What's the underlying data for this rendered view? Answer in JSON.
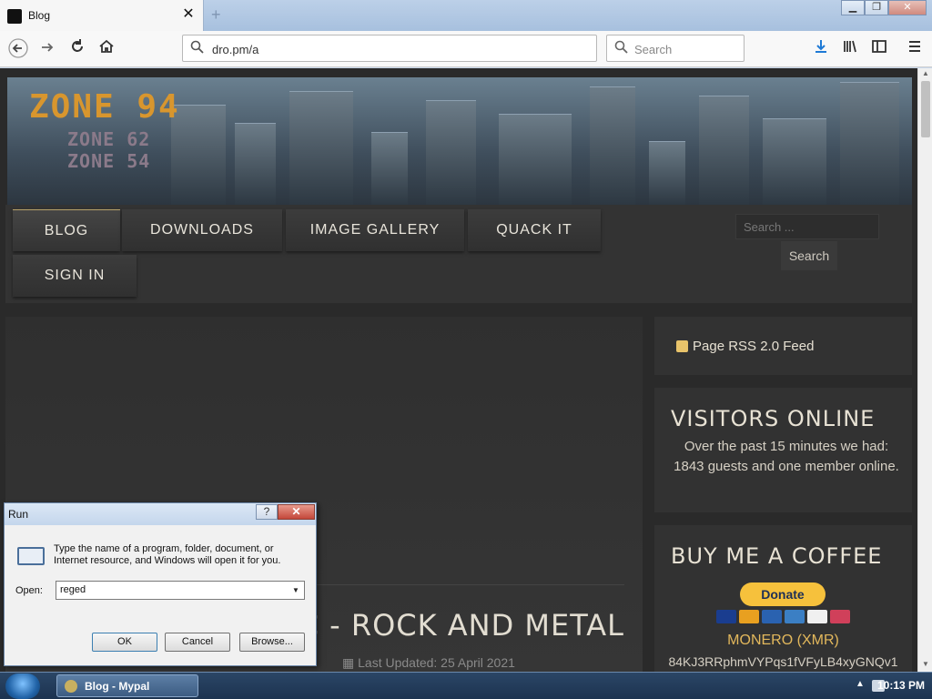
{
  "browser": {
    "tab_title": "Blog",
    "url": "dro.pm/a",
    "search_placeholder": "Search"
  },
  "site": {
    "logo": "ZONE 94",
    "logo_sub_1": "ZONE 62",
    "logo_sub_2": "ZONE 54",
    "menu": [
      "BLOG",
      "DOWNLOADS",
      "IMAGE GALLERY",
      "QUACK IT",
      "SIGN IN"
    ],
    "search_placeholder": "Search ...",
    "search_button": "Search"
  },
  "main": {
    "heading": "SIC - ROCK AND METAL",
    "last_updated": "Last Updated: 25 April 2021"
  },
  "sidebar": {
    "rss": "Page RSS 2.0 Feed",
    "visitors_title": "VISITORS ONLINE",
    "visitors_text": "Over the past 15 minutes we had: 1843 guests and one member online.",
    "coffee_title": "BUY ME A COFFEE",
    "donate": "Donate",
    "monero": "MONERO (XMR)",
    "monero_address": "84KJ3RRphmVYPqs1fVFyLB4xyGNQv1"
  },
  "run_dialog": {
    "title": "Run",
    "help": "?",
    "description": "Type the name of a program, folder, document, or Internet resource, and Windows will open it for you.",
    "open_label": "Open:",
    "open_value": "reged",
    "ok": "OK",
    "cancel": "Cancel",
    "browse": "Browse..."
  },
  "taskbar": {
    "task_label": "Blog - Mypal",
    "clock": "10:13 PM"
  }
}
